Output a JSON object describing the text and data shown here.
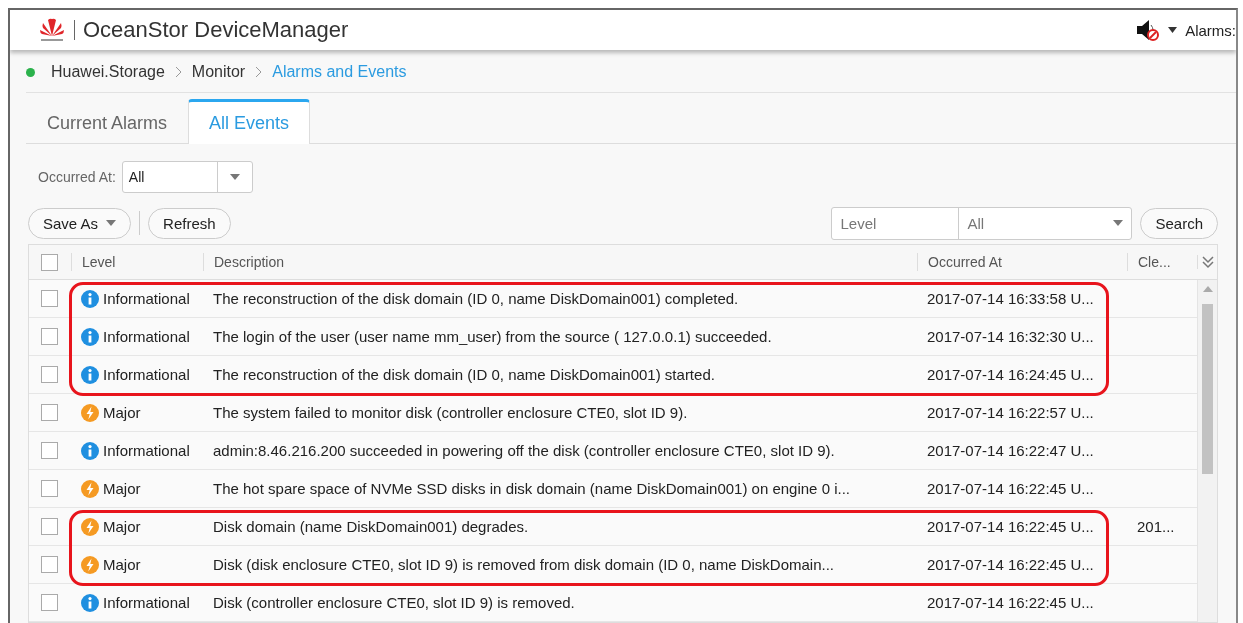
{
  "window": {
    "title": "OceanStor DeviceManager",
    "alarms_label": "Alarms:"
  },
  "breadcrumb": [
    {
      "label": "Huawei.Storage",
      "current": false
    },
    {
      "label": "Monitor",
      "current": false
    },
    {
      "label": "Alarms and Events",
      "current": true
    }
  ],
  "tabs": [
    {
      "label": "Current Alarms",
      "selected": false
    },
    {
      "label": "All Events",
      "selected": true
    }
  ],
  "filter": {
    "label": "Occurred At:",
    "value": "All"
  },
  "toolbar": {
    "save_as": "Save As",
    "refresh": "Refresh",
    "level_placeholder": "Level",
    "level_value": "All",
    "search": "Search"
  },
  "table": {
    "select_all_checked": false,
    "columns": [
      "Level",
      "Description",
      "Occurred At",
      "Cle..."
    ],
    "rows": [
      {
        "checked": false,
        "kind": "info",
        "level": "Informational",
        "description": "The reconstruction of the disk domain (ID  0, name DiskDomain001) completed.",
        "occurred_at": "2017-07-14 16:33:58 U...",
        "highlighted": true
      },
      {
        "checked": false,
        "kind": "info",
        "level": "Informational",
        "description": "The login of the user (user name mm_user) from the source ( 127.0.0.1) succeeded.",
        "occurred_at": "2017-07-14 16:32:30 U...",
        "highlighted": true
      },
      {
        "checked": false,
        "kind": "info",
        "level": "Informational",
        "description": "The reconstruction of the disk domain (ID  0, name DiskDomain001) started.",
        "occurred_at": "2017-07-14 16:24:45 U...",
        "highlighted": true
      },
      {
        "checked": false,
        "kind": "major",
        "level": "Major",
        "description": "The system failed to monitor disk (controller enclosure CTE0, slot ID 9).",
        "occurred_at": "2017-07-14 16:22:57 U...",
        "highlighted": false
      },
      {
        "checked": false,
        "kind": "info",
        "level": "Informational",
        "description": "admin:8.46.216.200 succeeded in powering off the disk (controller enclosure  CTE0, slot ID  9).",
        "occurred_at": "2017-07-14 16:22:47 U...",
        "highlighted": false
      },
      {
        "checked": false,
        "kind": "major",
        "level": "Major",
        "description": "The hot spare space of NVMe SSD disks in disk domain (name DiskDomain001) on engine 0 i...",
        "occurred_at": "2017-07-14 16:22:45 U...",
        "highlighted": false
      },
      {
        "checked": false,
        "kind": "major",
        "level": "Major",
        "description": "Disk domain (name DiskDomain001) degrades.",
        "occurred_at": "2017-07-14 16:22:45 U...",
        "cleared": "201...",
        "highlighted": true
      },
      {
        "checked": false,
        "kind": "major",
        "level": "Major",
        "description": "Disk (disk enclosure  CTE0, slot ID  9) is removed from disk domain (ID  0, name DiskDomain...",
        "occurred_at": "2017-07-14 16:22:45 U...",
        "highlighted": true
      },
      {
        "checked": false,
        "kind": "info",
        "level": "Informational",
        "description": "Disk (controller enclosure CTE0, slot ID 9) is removed.",
        "occurred_at": "2017-07-14 16:22:45 U...",
        "highlighted": false
      }
    ]
  }
}
